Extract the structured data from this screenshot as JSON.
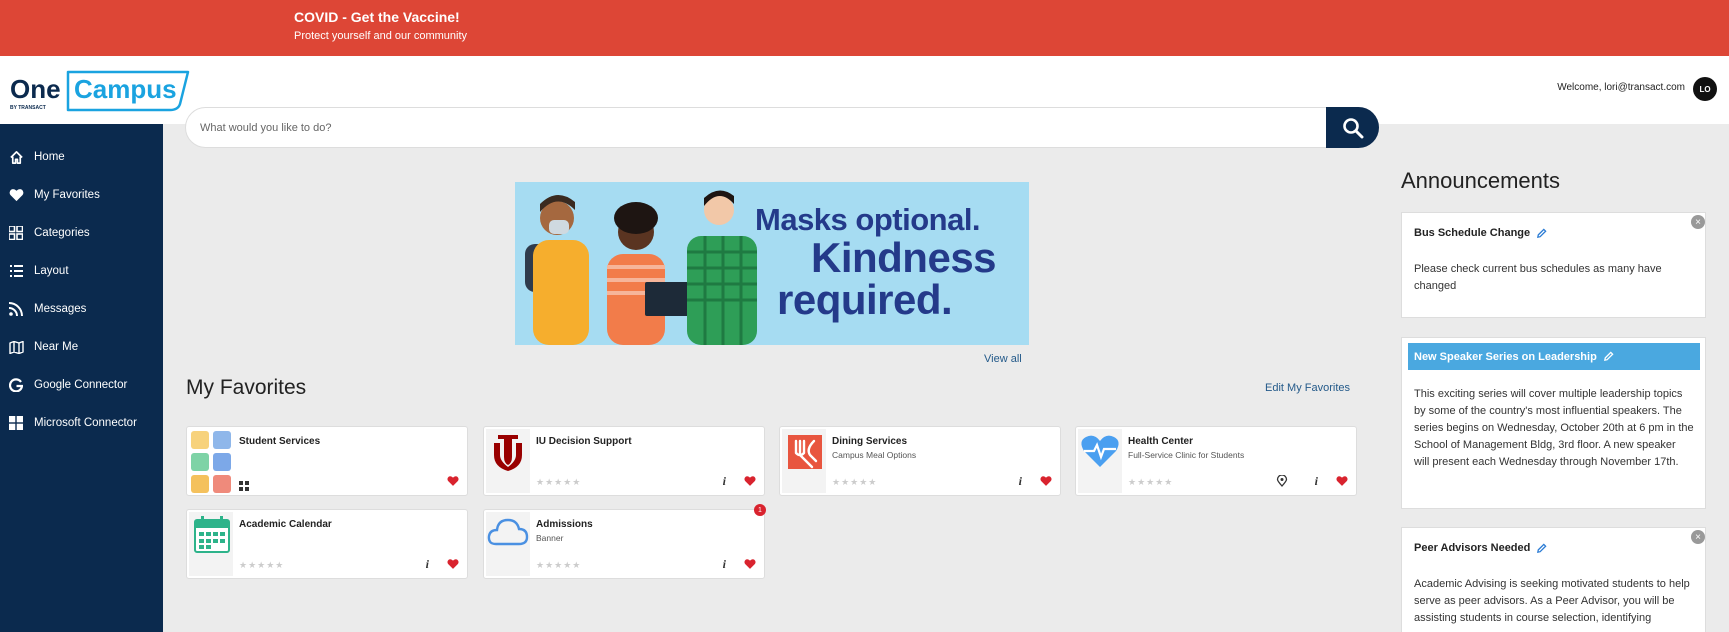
{
  "banner": {
    "title": "COVID - Get the Vaccine!",
    "subtitle": "Protect yourself and our community"
  },
  "header": {
    "logo_text": "OneCampus",
    "logo_sub": "BY TRANSACT",
    "welcome": "Welcome, lori@transact.com",
    "avatar_initials": "LO"
  },
  "search": {
    "placeholder": "What would you like to do?"
  },
  "sidebar": {
    "items": [
      {
        "label": "Home",
        "icon": "home-icon"
      },
      {
        "label": "My Favorites",
        "icon": "heart-icon"
      },
      {
        "label": "Categories",
        "icon": "grid-icon"
      },
      {
        "label": "Layout",
        "icon": "list-icon"
      },
      {
        "label": "Messages",
        "icon": "rss-icon"
      },
      {
        "label": "Near Me",
        "icon": "map-icon"
      },
      {
        "label": "Google Connector",
        "icon": "google-icon"
      },
      {
        "label": "Microsoft Connector",
        "icon": "windows-icon"
      }
    ]
  },
  "promo": {
    "line1": "Masks optional.",
    "line2": "Kindness",
    "line3": "required.",
    "view_all": "View all"
  },
  "favorites": {
    "title": "My Favorites",
    "edit_label": "Edit My Favorites",
    "cards": [
      {
        "title": "Student Services",
        "subtitle": "",
        "icon": "student-services-icon"
      },
      {
        "title": "IU Decision Support",
        "subtitle": "",
        "icon": "iu-logo-icon"
      },
      {
        "title": "Dining Services",
        "subtitle": "Campus Meal Options",
        "icon": "dining-icon"
      },
      {
        "title": "Health Center",
        "subtitle": "Full-Service Clinic for Students",
        "icon": "heartbeat-icon"
      },
      {
        "title": "Academic Calendar",
        "subtitle": "",
        "icon": "calendar-icon"
      },
      {
        "title": "Admissions",
        "subtitle": "Banner",
        "icon": "cloud-icon",
        "badge": "1"
      }
    ],
    "stars": "★★★★★",
    "info_glyph": "i"
  },
  "announcements": {
    "title": "Announcements",
    "items": [
      {
        "title": "Bus Schedule Change",
        "body": "Please check current bus schedules as many have changed"
      },
      {
        "title": "New Speaker Series on Leadership",
        "body": "This exciting series will cover multiple leadership topics by some of the country's most influential speakers. The series begins on Wednesday, October 20th at 6 pm in the School of Management Bldg, 3rd floor. A new speaker will present each Wednesday through November 17th."
      },
      {
        "title": "Peer Advisors Needed",
        "body": "Academic Advising is seeking motivated students to help serve as peer advisors. As a Peer Advisor, you will be assisting students in course selection, identifying"
      }
    ],
    "close_glyph": "×"
  },
  "colors": {
    "banner": "#dd4636",
    "navy": "#0b2a4e",
    "accent_blue": "#4aa8e0",
    "heart_red": "#d9232e"
  }
}
